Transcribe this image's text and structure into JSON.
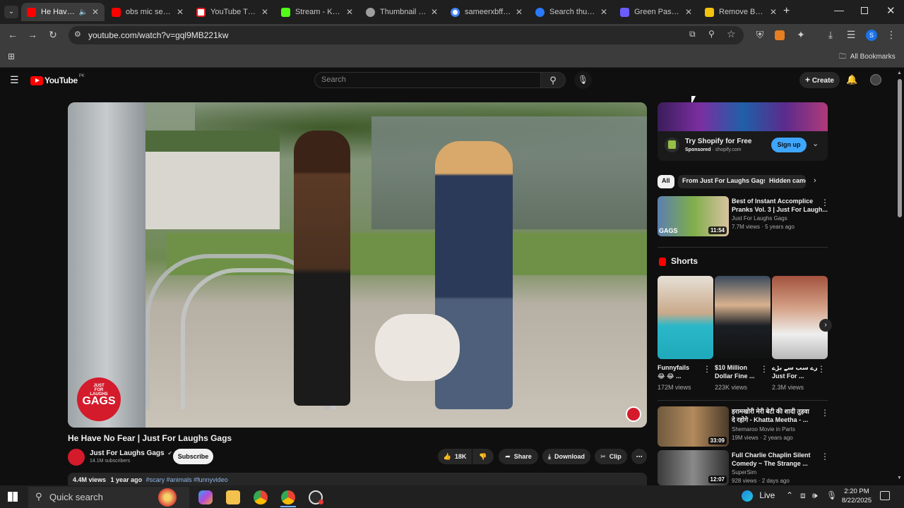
{
  "browser": {
    "tabs": [
      {
        "title": "He Have N",
        "color": "#ff0000",
        "active": true
      },
      {
        "title": "obs mic settin",
        "color": "#ff0000",
        "active": false
      },
      {
        "title": "YouTube Thum",
        "color": "#e91e1e",
        "active": false
      },
      {
        "title": "Stream - Kick",
        "color": "#53fc18",
        "active": false
      },
      {
        "title": "Thumbnail exp",
        "color": "#9e9e9e",
        "active": false
      },
      {
        "title": "sameerxbff - G",
        "color": "#4285f4",
        "active": false
      },
      {
        "title": "Search thumb",
        "color": "#2979ff",
        "active": false
      },
      {
        "title": "Green Passive",
        "color": "#6a5cff",
        "active": false
      },
      {
        "title": "Remove Backg",
        "color": "#f4c20d",
        "active": false
      }
    ],
    "url": "youtube.com/watch?v=gql9MB221kw",
    "bookmarks_label": "All Bookmarks",
    "profile_initial": "S"
  },
  "youtube": {
    "logo_text": "YouTube",
    "region": "PK",
    "search_placeholder": "Search",
    "create_label": "Create",
    "video": {
      "title": "He Have No Fear | Just For Laughs Gags",
      "channel": "Just For Laughs Gags",
      "subscribers": "14.1M subscribers",
      "subscribe_label": "Subscribe",
      "likes": "18K",
      "share_label": "Share",
      "download_label": "Download",
      "clip_label": "Clip",
      "views": "4.4M views",
      "age": "1 year ago",
      "hashtags": "#scary #animals #funnyvideo",
      "watermark_lines": [
        "JUST",
        "FOR",
        "LAUGHS",
        "GAGS"
      ]
    },
    "ad": {
      "title": "Try Shopify for Free",
      "sponsored": "Sponsored",
      "domain": "shopify.com",
      "cta": "Sign up"
    },
    "chips": [
      "All",
      "From Just For Laughs Gags",
      "Hidden came"
    ],
    "recommended_top": {
      "title_line1": "Best of Instant Accomplice",
      "title_line2": "Pranks Vol. 3 | Just For Laugh...",
      "channel": "Just For Laughs Gags",
      "views": "7.7M views",
      "age": "5 years ago",
      "duration": "11:54",
      "thumb_label": "GAGS"
    },
    "shorts": {
      "heading": "Shorts",
      "items": [
        {
          "title_line1": "Funnyfails",
          "title_line2": "😂 😂 ...",
          "views": "172M views"
        },
        {
          "title_line1": "$10 Million",
          "title_line2": "Dollar Fine ...",
          "views": "223K views"
        },
        {
          "title_line1": "تمہارے سب سے بڑے...|",
          "title_line2": "Just For ...",
          "views": "2.3M views"
        }
      ]
    },
    "recommended_bottom": [
      {
        "title_line1": "हरामखोरी मेरी बेटी की शादी तुड़वा",
        "title_line2": "दे रहोगे - Khatta Meetha - ...",
        "channel": "Shemaroo Movie in Parts",
        "views": "19M views",
        "age": "2 years ago",
        "duration": "33:09"
      },
      {
        "title_line1": "Full Charlie Chaplin Silent",
        "title_line2": "Comedy ~ The Strange ...",
        "channel": "SuperSim",
        "views": "928 views",
        "age": "2 days ago",
        "duration": "12:07"
      }
    ]
  },
  "taskbar": {
    "search_placeholder": "Quick search",
    "live_label": "Live",
    "time": "2:20 PM",
    "date": "8/22/2025"
  },
  "colors": {
    "background": "#0f0f0f",
    "youtube_red": "#ff0000",
    "signup_blue": "#3ea6ff"
  }
}
